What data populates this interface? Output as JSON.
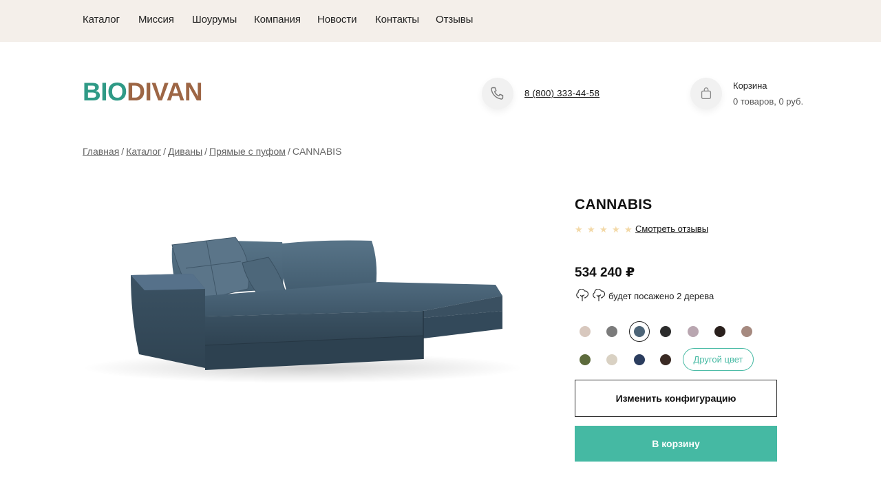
{
  "nav": {
    "items": [
      "Каталог",
      "Миссия",
      "Шоурумы",
      "Компания",
      "Новости",
      "Контакты",
      "Отзывы"
    ]
  },
  "brand": {
    "logo_part1": "BIO",
    "logo_part2": "DIVAN"
  },
  "header": {
    "phone": "8 (800) 333-44-58",
    "cart_title": "Корзина",
    "cart_summary": "0 товаров, 0 руб."
  },
  "breadcrumb": {
    "items": [
      "Главная",
      "Каталог",
      "Диваны",
      "Прямые с пуфом"
    ],
    "separator": "/",
    "current": "CANNABIS"
  },
  "product": {
    "title": "CANNABIS",
    "rating_stars": 5,
    "reviews_link": "Смотреть отзывы",
    "price": "534 240 ₽",
    "trees_text": "будет посажено 2 дерева",
    "other_color_label": "Другой цвет",
    "config_button": "Изменить конфигурацию",
    "cart_button": "В корзину",
    "selected_color_index": 2
  },
  "colors": {
    "accent": "#45b9a3",
    "logo_green": "#2f9a86",
    "logo_brown": "#9d6645",
    "topbar_bg": "#f4efea",
    "swatches_row1": [
      "#d8c8be",
      "#7b7b7b",
      "#4d6578",
      "#2c2c2c",
      "#b9a6b0",
      "#2a201d",
      "#a68a80"
    ],
    "swatches_row2": [
      "#5d6b3c",
      "#d9d1c3",
      "#2b3d5e",
      "#3a2a24"
    ]
  }
}
